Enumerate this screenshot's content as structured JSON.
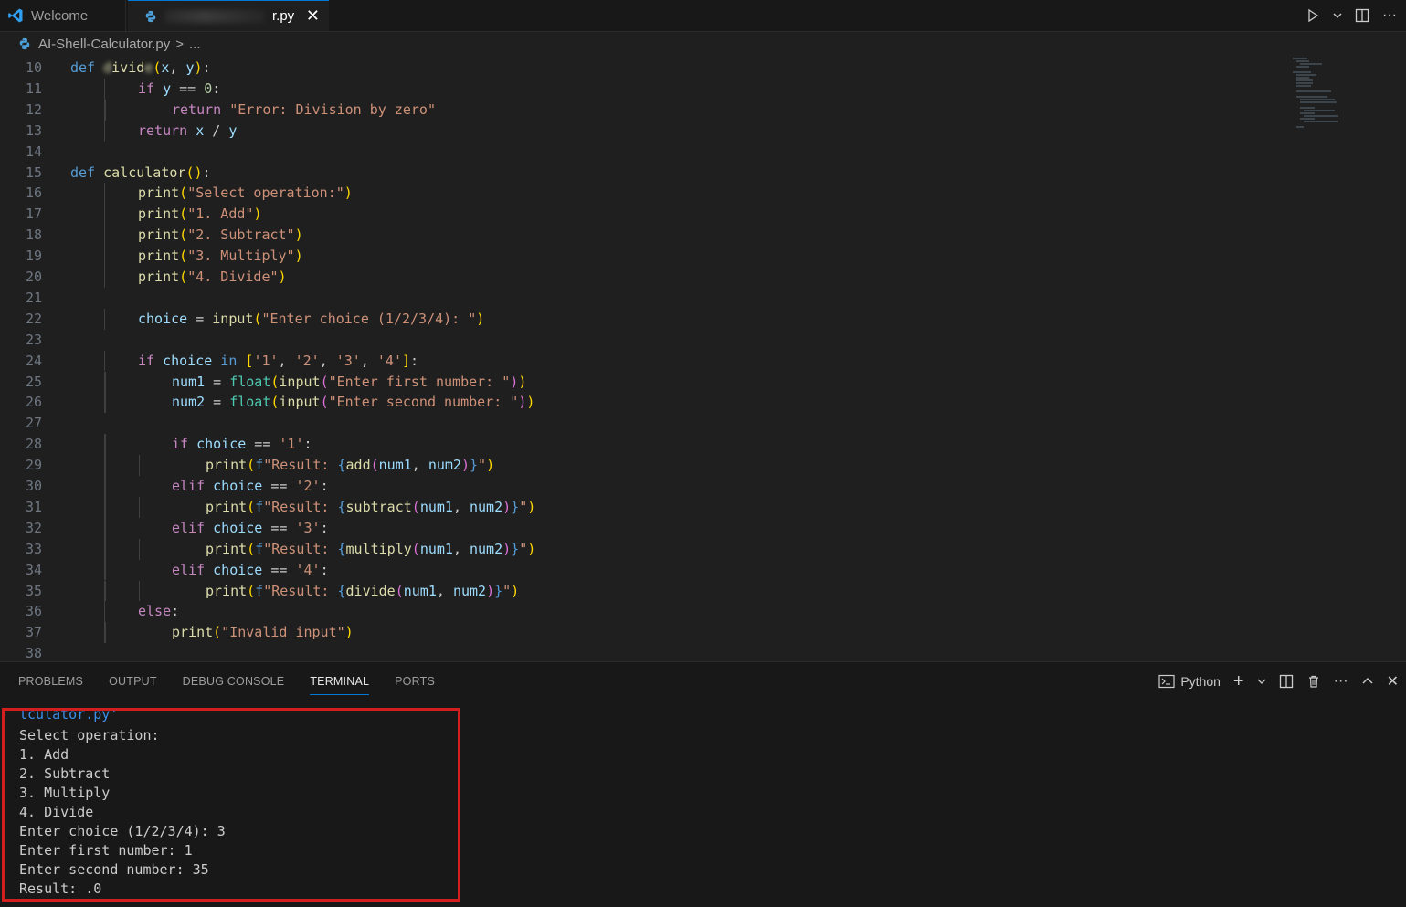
{
  "tabs": [
    {
      "label": "Welcome",
      "icon": "vscode-logo-icon"
    },
    {
      "label": "r.py",
      "icon": "python-file-icon",
      "obscured_prefix": true
    }
  ],
  "breadcrumb": {
    "file": "AI-Shell-Calculator.py",
    "separator": ">",
    "rest": "..."
  },
  "editor": {
    "lines": [
      {
        "n": "10",
        "indent": 0,
        "tokens": [
          [
            "kw",
            "def "
          ],
          [
            "fn blurtxt",
            "d"
          ],
          [
            "fn",
            "ivid"
          ],
          [
            "fn blurtxt",
            "e"
          ],
          [
            "p1",
            "("
          ],
          [
            "var",
            "x"
          ],
          [
            "",
            ", "
          ],
          [
            "var",
            "y"
          ],
          [
            "p1",
            ")"
          ],
          [
            "",
            ":"
          ]
        ]
      },
      {
        "n": "11",
        "indent": 2,
        "tokens": [
          [
            "ctl",
            "if "
          ],
          [
            "var",
            "y"
          ],
          [
            "",
            " == "
          ],
          [
            "num",
            "0"
          ],
          [
            "",
            ":"
          ]
        ]
      },
      {
        "n": "12",
        "indent": 3,
        "tokens": [
          [
            "ctl",
            "return "
          ],
          [
            "str",
            "\"Error: Division by zero\""
          ]
        ]
      },
      {
        "n": "13",
        "indent": 2,
        "tokens": [
          [
            "ctl",
            "return "
          ],
          [
            "var",
            "x"
          ],
          [
            "",
            " / "
          ],
          [
            "var",
            "y"
          ]
        ]
      },
      {
        "n": "14",
        "indent": 0,
        "tokens": []
      },
      {
        "n": "15",
        "indent": 0,
        "tokens": [
          [
            "kw",
            "def "
          ],
          [
            "fn",
            "calculator"
          ],
          [
            "p1",
            "()"
          ],
          [
            "",
            ":"
          ]
        ]
      },
      {
        "n": "16",
        "indent": 2,
        "tokens": [
          [
            "fn",
            "print"
          ],
          [
            "p1",
            "("
          ],
          [
            "str",
            "\"Select operation:\""
          ],
          [
            "p1",
            ")"
          ]
        ]
      },
      {
        "n": "17",
        "indent": 2,
        "tokens": [
          [
            "fn",
            "print"
          ],
          [
            "p1",
            "("
          ],
          [
            "str",
            "\"1. Add\""
          ],
          [
            "p1",
            ")"
          ]
        ]
      },
      {
        "n": "18",
        "indent": 2,
        "tokens": [
          [
            "fn",
            "print"
          ],
          [
            "p1",
            "("
          ],
          [
            "str",
            "\"2. Subtract\""
          ],
          [
            "p1",
            ")"
          ]
        ]
      },
      {
        "n": "19",
        "indent": 2,
        "tokens": [
          [
            "fn",
            "print"
          ],
          [
            "p1",
            "("
          ],
          [
            "str",
            "\"3. Multiply\""
          ],
          [
            "p1",
            ")"
          ]
        ]
      },
      {
        "n": "20",
        "indent": 2,
        "tokens": [
          [
            "fn",
            "print"
          ],
          [
            "p1",
            "("
          ],
          [
            "str",
            "\"4. Divide\""
          ],
          [
            "p1",
            ")"
          ]
        ]
      },
      {
        "n": "21",
        "indent": 0,
        "tokens": []
      },
      {
        "n": "22",
        "indent": 2,
        "tokens": [
          [
            "var",
            "choice"
          ],
          [
            "",
            " = "
          ],
          [
            "fn",
            "input"
          ],
          [
            "p1",
            "("
          ],
          [
            "str",
            "\"Enter choice (1/2/3/4): \""
          ],
          [
            "p1",
            ")"
          ]
        ]
      },
      {
        "n": "23",
        "indent": 0,
        "tokens": []
      },
      {
        "n": "24",
        "indent": 2,
        "tokens": [
          [
            "ctl",
            "if "
          ],
          [
            "var",
            "choice"
          ],
          [
            "kw",
            " in "
          ],
          [
            "p1",
            "["
          ],
          [
            "str",
            "'1'"
          ],
          [
            "",
            ", "
          ],
          [
            "str",
            "'2'"
          ],
          [
            "",
            ", "
          ],
          [
            "str",
            "'3'"
          ],
          [
            "",
            ", "
          ],
          [
            "str",
            "'4'"
          ],
          [
            "p1",
            "]"
          ],
          [
            "",
            ":"
          ]
        ]
      },
      {
        "n": "25",
        "indent": 3,
        "tokens": [
          [
            "var",
            "num1"
          ],
          [
            "",
            " = "
          ],
          [
            "bi",
            "float"
          ],
          [
            "p1",
            "("
          ],
          [
            "fn",
            "input"
          ],
          [
            "p2",
            "("
          ],
          [
            "str",
            "\"Enter first number: \""
          ],
          [
            "p2",
            ")"
          ],
          [
            "p1",
            ")"
          ]
        ]
      },
      {
        "n": "26",
        "indent": 3,
        "tokens": [
          [
            "var",
            "num2"
          ],
          [
            "",
            " = "
          ],
          [
            "bi",
            "float"
          ],
          [
            "p1",
            "("
          ],
          [
            "fn",
            "input"
          ],
          [
            "p2",
            "("
          ],
          [
            "str",
            "\"Enter second number: \""
          ],
          [
            "p2",
            ")"
          ],
          [
            "p1",
            ")"
          ]
        ]
      },
      {
        "n": "27",
        "indent": 0,
        "tokens": []
      },
      {
        "n": "28",
        "indent": 3,
        "tokens": [
          [
            "ctl",
            "if "
          ],
          [
            "var",
            "choice"
          ],
          [
            "",
            " == "
          ],
          [
            "str",
            "'1'"
          ],
          [
            "",
            ":"
          ]
        ]
      },
      {
        "n": "29",
        "indent": 4,
        "tokens": [
          [
            "fn",
            "print"
          ],
          [
            "p1",
            "("
          ],
          [
            "kw",
            "f"
          ],
          [
            "str",
            "\"Result: "
          ],
          [
            "kw",
            "{"
          ],
          [
            "fn",
            "add"
          ],
          [
            "p2",
            "("
          ],
          [
            "var",
            "num1"
          ],
          [
            "",
            ", "
          ],
          [
            "var",
            "num2"
          ],
          [
            "p2",
            ")"
          ],
          [
            "kw",
            "}"
          ],
          [
            "str",
            "\""
          ],
          [
            "p1",
            ")"
          ]
        ]
      },
      {
        "n": "30",
        "indent": 3,
        "tokens": [
          [
            "ctl",
            "elif "
          ],
          [
            "var",
            "choice"
          ],
          [
            "",
            " == "
          ],
          [
            "str",
            "'2'"
          ],
          [
            "",
            ":"
          ]
        ]
      },
      {
        "n": "31",
        "indent": 4,
        "tokens": [
          [
            "fn",
            "print"
          ],
          [
            "p1",
            "("
          ],
          [
            "kw",
            "f"
          ],
          [
            "str",
            "\"Result: "
          ],
          [
            "kw",
            "{"
          ],
          [
            "fn",
            "subtract"
          ],
          [
            "p2",
            "("
          ],
          [
            "var",
            "num1"
          ],
          [
            "",
            ", "
          ],
          [
            "var",
            "num2"
          ],
          [
            "p2",
            ")"
          ],
          [
            "kw",
            "}"
          ],
          [
            "str",
            "\""
          ],
          [
            "p1",
            ")"
          ]
        ]
      },
      {
        "n": "32",
        "indent": 3,
        "tokens": [
          [
            "ctl",
            "elif "
          ],
          [
            "var",
            "choice"
          ],
          [
            "",
            " == "
          ],
          [
            "str",
            "'3'"
          ],
          [
            "",
            ":"
          ]
        ]
      },
      {
        "n": "33",
        "indent": 4,
        "tokens": [
          [
            "fn",
            "print"
          ],
          [
            "p1",
            "("
          ],
          [
            "kw",
            "f"
          ],
          [
            "str",
            "\"Result: "
          ],
          [
            "kw",
            "{"
          ],
          [
            "fn",
            "multiply"
          ],
          [
            "p2",
            "("
          ],
          [
            "var",
            "num1"
          ],
          [
            "",
            ", "
          ],
          [
            "var",
            "num2"
          ],
          [
            "p2",
            ")"
          ],
          [
            "kw",
            "}"
          ],
          [
            "str",
            "\""
          ],
          [
            "p1",
            ")"
          ]
        ]
      },
      {
        "n": "34",
        "indent": 3,
        "tokens": [
          [
            "ctl",
            "elif "
          ],
          [
            "var",
            "choice"
          ],
          [
            "",
            " == "
          ],
          [
            "str",
            "'4'"
          ],
          [
            "",
            ":"
          ]
        ]
      },
      {
        "n": "35",
        "indent": 4,
        "tokens": [
          [
            "fn",
            "print"
          ],
          [
            "p1",
            "("
          ],
          [
            "kw",
            "f"
          ],
          [
            "str",
            "\"Result: "
          ],
          [
            "kw",
            "{"
          ],
          [
            "fn",
            "divide"
          ],
          [
            "p2",
            "("
          ],
          [
            "var",
            "num1"
          ],
          [
            "",
            ", "
          ],
          [
            "var",
            "num2"
          ],
          [
            "p2",
            ")"
          ],
          [
            "kw",
            "}"
          ],
          [
            "str",
            "\""
          ],
          [
            "p1",
            ")"
          ]
        ]
      },
      {
        "n": "36",
        "indent": 2,
        "tokens": [
          [
            "ctl",
            "else"
          ],
          [
            "",
            ":"
          ]
        ]
      },
      {
        "n": "37",
        "indent": 3,
        "tokens": [
          [
            "fn",
            "print"
          ],
          [
            "p1",
            "("
          ],
          [
            "str",
            "\"Invalid input\""
          ],
          [
            "p1",
            ")"
          ]
        ]
      },
      {
        "n": "38",
        "indent": 0,
        "tokens": []
      }
    ]
  },
  "panel": {
    "tabs": [
      "PROBLEMS",
      "OUTPUT",
      "DEBUG CONSOLE",
      "TERMINAL",
      "PORTS"
    ],
    "active_tab": "TERMINAL",
    "terminal_profile": "Python"
  },
  "terminal": {
    "cut_line": "lculator.py'",
    "lines": [
      "Select operation:",
      "1. Add",
      "2. Subtract",
      "3. Multiply",
      "4. Divide",
      "Enter choice (1/2/3/4): 3",
      "Enter first number: 1",
      "Enter second number: 35",
      "Result: .0"
    ]
  },
  "colors": {
    "accent": "#0078d4",
    "highlight_box": "#d11f1f"
  }
}
